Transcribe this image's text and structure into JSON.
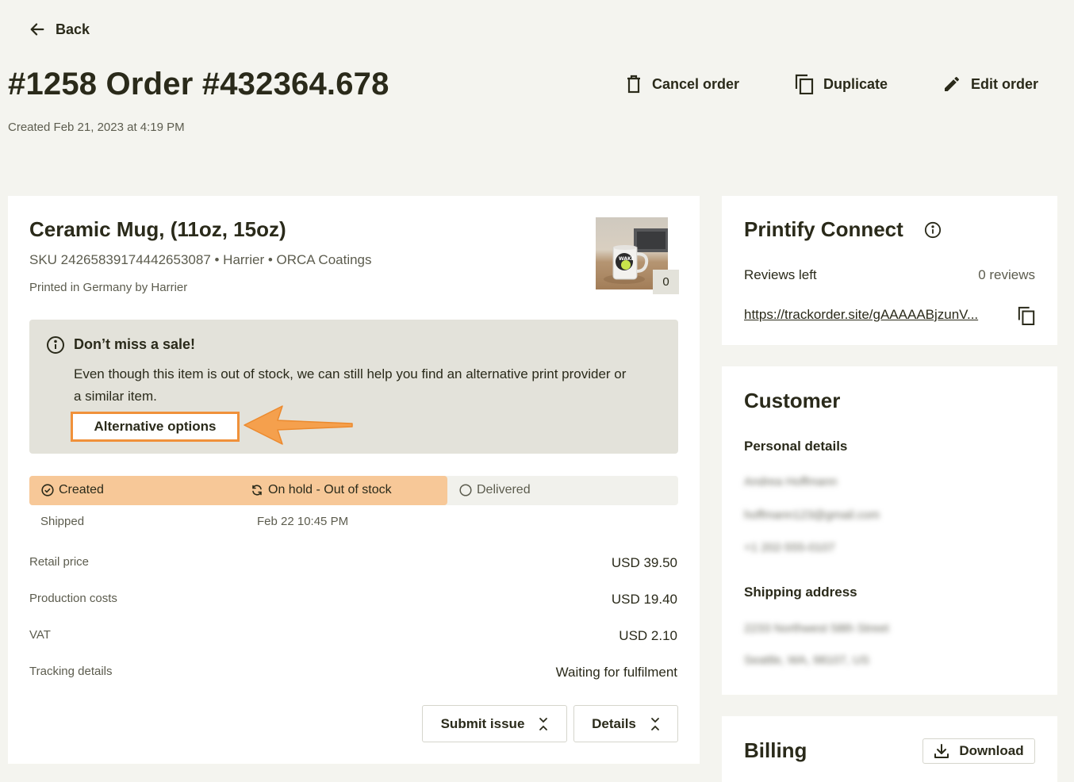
{
  "nav": {
    "back_label": "Back"
  },
  "order": {
    "title": "#1258 Order #432364.678",
    "created": "Created Feb 21, 2023  at 4:19 PM"
  },
  "actions": {
    "cancel": "Cancel order",
    "duplicate": "Duplicate",
    "edit": "Edit order"
  },
  "product": {
    "name": "Ceramic Mug, (11oz, 15oz)",
    "sku_line": "SKU 24265839174442653087  •  Harrier  •  ORCA Coatings",
    "printed_in": "Printed in Germany by Harrier",
    "quantity_badge": "0"
  },
  "alert": {
    "title": "Don’t miss a sale!",
    "body": "Even though this item is out of stock, we can still help you find an alternative print provider or a similar item.",
    "button": "Alternative options",
    "highlight_color": "#f0913a"
  },
  "status": {
    "steps": [
      "Created",
      "On hold - Out of stock",
      "Delivered"
    ],
    "shipped_label": "Shipped",
    "shipped_date": "Feb 22  10:45 PM"
  },
  "pricing": [
    {
      "label": "Retail price",
      "value": "USD 39.50"
    },
    {
      "label": "Production costs",
      "value": "USD 19.40"
    },
    {
      "label": "VAT",
      "value": "USD 2.10"
    },
    {
      "label": "Tracking details",
      "value": "Waiting for fulfilment"
    }
  ],
  "buttons": {
    "submit_issue": "Submit issue",
    "details": "Details"
  },
  "connect": {
    "title": "Printify Connect",
    "reviews_label": "Reviews left",
    "reviews_value": "0 reviews",
    "link": "https://trackorder.site/gAAAAABjzunV..."
  },
  "customer": {
    "title": "Customer",
    "personal_label": "Personal details",
    "name": "Andrea Hoffmann",
    "email": "hoffmann123@gmail.com",
    "phone": "+1 202-555-0107",
    "shipping_label": "Shipping address",
    "address_line1": "2233 Northwest 58th Street",
    "address_line2": "Seattle, WA, 98107, US"
  },
  "billing": {
    "title": "Billing",
    "download": "Download"
  },
  "colors": {
    "status_fill": "#f7c898",
    "accent_orange": "#f0913a",
    "alert_bg": "#e3e2da",
    "page_bg": "#f4f4ef"
  }
}
